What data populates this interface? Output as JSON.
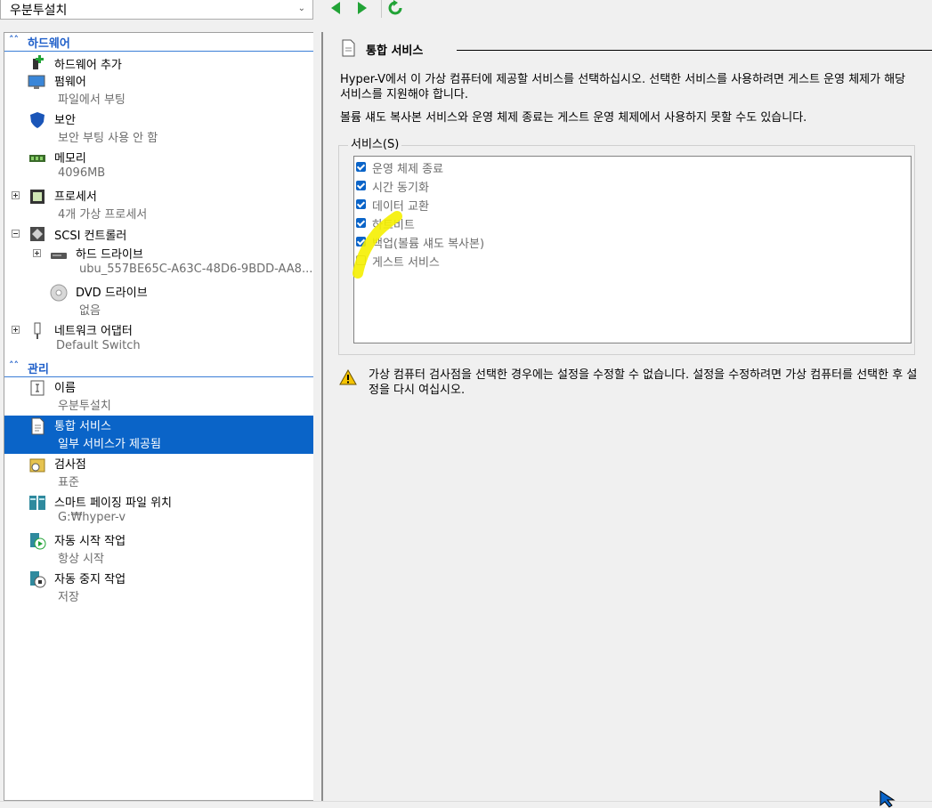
{
  "toolbar": {
    "vm_name": "우분투설치",
    "back_icon": "green-left-arrow-icon",
    "forward_icon": "green-right-arrow-icon",
    "refresh_icon": "green-refresh-icon"
  },
  "sidebar": {
    "hardware_header": "하드웨어",
    "management_header": "관리",
    "hardware": {
      "add_hardware": "하드웨어 추가",
      "firmware": {
        "label": "펌웨어",
        "sub": "파일에서 부팅"
      },
      "security": {
        "label": "보안",
        "sub": "보안 부팅 사용 안 함"
      },
      "memory": {
        "label": "메모리",
        "sub": "4096MB"
      },
      "processor": {
        "label": "프로세서",
        "sub": "4개 가상 프로세서"
      },
      "scsi": {
        "label": "SCSI 컨트롤러"
      },
      "hard_drive": {
        "label": "하드 드라이브",
        "sub": "ubu_557BE65C-A63C-48D6-9BDD-AA8..."
      },
      "dvd_drive": {
        "label": "DVD 드라이브",
        "sub": "없음"
      },
      "network": {
        "label": "네트워크 어댑터",
        "sub": "Default Switch"
      }
    },
    "management": {
      "name": {
        "label": "이름",
        "sub": "우분투설치"
      },
      "integration": {
        "label": "통합 서비스",
        "sub": "일부 서비스가 제공됨"
      },
      "checkpoint": {
        "label": "검사점",
        "sub": "표준"
      },
      "paging": {
        "label": "스마트 페이징 파일 위치",
        "sub": "G:₩hyper-v"
      },
      "autostart": {
        "label": "자동 시작 작업",
        "sub": "항상 시작"
      },
      "autostop": {
        "label": "자동 중지 작업",
        "sub": "저장"
      }
    }
  },
  "main": {
    "title": "통합 서비스",
    "description1": "Hyper-V에서 이 가상 컴퓨터에 제공할 서비스를 선택하십시오. 선택한 서비스를 사용하려면 게스트 운영 체제가 해당 서비스를 지원해야 합니다.",
    "description2": "볼륨 섀도 복사본 서비스와 운영 체제 종료는 게스트 운영 체제에서 사용하지 못할 수도 있습니다.",
    "services_label": "서비스(S)",
    "services": [
      {
        "label": "운영 체제 종료",
        "checked": true
      },
      {
        "label": "시간 동기화",
        "checked": true
      },
      {
        "label": "데이터 교환",
        "checked": true
      },
      {
        "label": "하트비트",
        "checked": true
      },
      {
        "label": "백업(볼륨 섀도 복사본)",
        "checked": true
      },
      {
        "label": "게스트 서비스",
        "checked": false
      }
    ],
    "warning": "가상 컴퓨터 검사점을 선택한 경우에는 설정을 수정할 수 없습니다. 설정을 수정하려면 가상 컴퓨터를 선택한 후 설정을 다시 여십시오."
  },
  "colors": {
    "accent": "#0a64c8",
    "header_text": "#1f5fc9",
    "highlight": "#f5f000"
  }
}
